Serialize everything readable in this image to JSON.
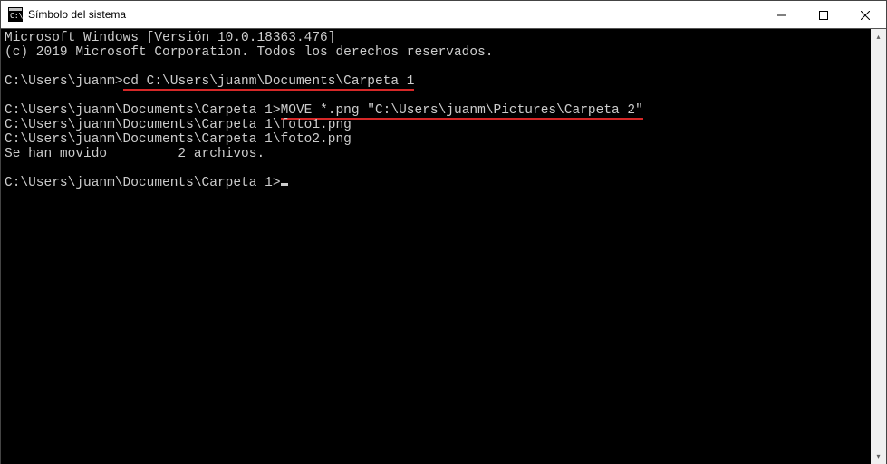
{
  "titlebar": {
    "title": "Símbolo del sistema"
  },
  "console": {
    "lines": [
      {
        "prompt": "",
        "text": "Microsoft Windows [Versión 10.0.18363.476]",
        "underline": false
      },
      {
        "prompt": "",
        "text": "(c) 2019 Microsoft Corporation. Todos los derechos reservados.",
        "underline": false
      },
      {
        "prompt": "",
        "text": "",
        "underline": false
      },
      {
        "prompt": "C:\\Users\\juanm>",
        "text": "cd C:\\Users\\juanm\\Documents\\Carpeta 1",
        "underline": true
      },
      {
        "prompt": "",
        "text": "",
        "underline": false
      },
      {
        "prompt": "C:\\Users\\juanm\\Documents\\Carpeta 1>",
        "text": "MOVE *.png \"C:\\Users\\juanm\\Pictures\\Carpeta 2\"",
        "underline": true
      },
      {
        "prompt": "",
        "text": "C:\\Users\\juanm\\Documents\\Carpeta 1\\foto1.png",
        "underline": false
      },
      {
        "prompt": "",
        "text": "C:\\Users\\juanm\\Documents\\Carpeta 1\\foto2.png",
        "underline": false
      },
      {
        "prompt": "",
        "text": "Se han movido         2 archivos.",
        "underline": false
      },
      {
        "prompt": "",
        "text": "",
        "underline": false
      },
      {
        "prompt": "C:\\Users\\juanm\\Documents\\Carpeta 1>",
        "text": "",
        "underline": false,
        "cursor": true
      }
    ]
  },
  "icons": {
    "cmd": "cmd-icon",
    "minimize": "minimize-icon",
    "maximize": "maximize-icon",
    "close": "close-icon",
    "scroll_up": "▴",
    "scroll_down": "▾"
  }
}
